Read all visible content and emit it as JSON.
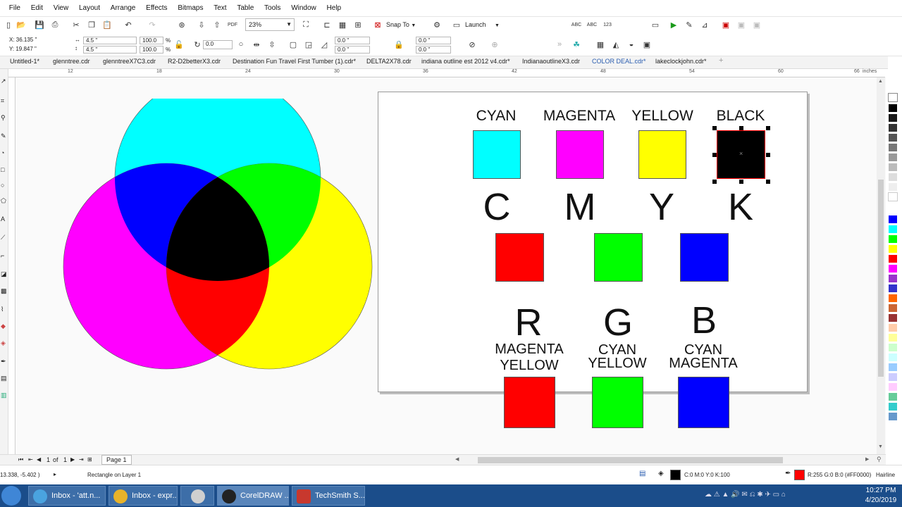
{
  "menu": [
    "File",
    "Edit",
    "View",
    "Layout",
    "Arrange",
    "Effects",
    "Bitmaps",
    "Text",
    "Table",
    "Tools",
    "Window",
    "Help"
  ],
  "toolbar": {
    "zoom": "23%",
    "snap_label": "Snap To",
    "launch_label": "Launch"
  },
  "propbar": {
    "x": "X: 36.135 \"",
    "y": "Y: 19.847 \"",
    "w": "4.5 \"",
    "h": "4.5 \"",
    "scale_w": "100.0",
    "scale_h": "100.0",
    "pct": "%",
    "angle": "0.0",
    "corner1": "0.0 \"",
    "corner2": "0.0 \"",
    "corner3": "0.0 \"",
    "corner4": "0.0 \""
  },
  "tabs": [
    "Untitled-1*",
    "glenntree.cdr",
    "glenntreeX7C3.cdr",
    "R2-D2betterX3.cdr",
    "Destination Fun Travel First Tumber (1).cdr*",
    "DELTA2X78.cdr",
    "indiana outline est 2012 v4.cdr*",
    "IndianaoutlineX3.cdr",
    "COLOR DEAL.cdr*",
    "lakeclockjohn.cdr*"
  ],
  "active_tab": "COLOR DEAL.cdr*",
  "ruler": {
    "ticks": [
      "12",
      "18",
      "24",
      "30",
      "36",
      "42",
      "48",
      "54",
      "60",
      "66"
    ],
    "unit": "inches"
  },
  "artwork": {
    "top_labels": [
      "CYAN",
      "MAGENTA",
      "YELLOW",
      "BLACK"
    ],
    "letters": [
      "C",
      "M",
      "Y",
      "K"
    ],
    "rgb_letters": [
      "R",
      "G",
      "B"
    ],
    "r_mix": [
      "MAGENTA",
      "YELLOW"
    ],
    "g_mix": [
      "CYAN",
      "YELLOW"
    ],
    "b_mix": [
      "CYAN",
      "MAGENTA"
    ]
  },
  "colors": {
    "cyan": "#00ffff",
    "magenta": "#ff00ff",
    "yellow": "#ffff00",
    "black": "#000000",
    "red": "#ff0000",
    "green": "#00ff00",
    "blue": "#0000ff"
  },
  "page_nav": {
    "current": "1",
    "of": "of",
    "total": "1",
    "page_tab": "Page 1"
  },
  "status": {
    "coords": "13.338, -5.402 )",
    "object": "Rectangle on Layer 1",
    "fill": "C:0 M:0 Y:0 K:100",
    "outline": "R:255 G:0 B:0 (#FF0000)",
    "outline_width": "Hairline"
  },
  "taskbar": {
    "items": [
      "Inbox - 'att.n...",
      "Inbox - expr...",
      "",
      "CorelDRAW ...",
      "TechSmith S..."
    ],
    "time": "10:27 PM",
    "date": "4/20/2019"
  }
}
